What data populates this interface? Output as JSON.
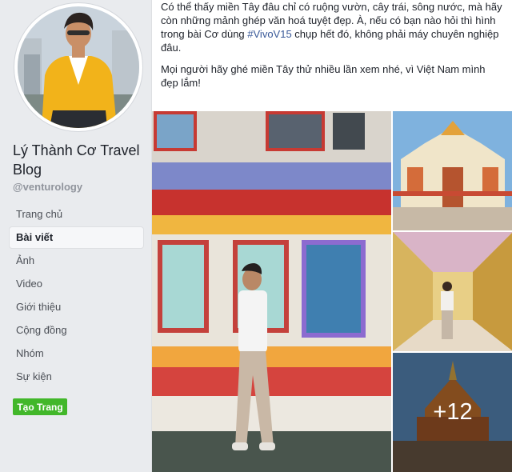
{
  "page": {
    "name": "Lý Thành Cơ Travel Blog",
    "handle": "@venturology"
  },
  "nav": [
    {
      "label": "Trang chủ"
    },
    {
      "label": "Bài viết",
      "active": true
    },
    {
      "label": "Ảnh"
    },
    {
      "label": "Video"
    },
    {
      "label": "Giới thiệu"
    },
    {
      "label": "Cộng đồng"
    },
    {
      "label": "Nhóm"
    },
    {
      "label": "Sự kiện"
    }
  ],
  "create_page_label": "Tạo Trang",
  "post": {
    "p1_before": "Có thể thấy miền Tây đâu chỉ có ruộng vườn, cây trái, sông nước, mà hãy còn những mảnh ghép văn hoá tuyệt đẹp. À, nếu có bạn nào hỏi thì hình trong bài Cơ dùng ",
    "hashtag": "#VivoV15",
    "p1_after": " chụp hết đó, không phải máy chuyên nghiệp đâu.",
    "p2": "Mọi người hãy ghé miền Tây thử nhiều lần xem nhé, vì Việt Nam mình đẹp lắm!"
  },
  "photos": {
    "more_count": "+12"
  },
  "colors": {
    "sidebar_bg": "#e9ebee",
    "hashtag": "#385898",
    "create_button": "#42b72a"
  }
}
